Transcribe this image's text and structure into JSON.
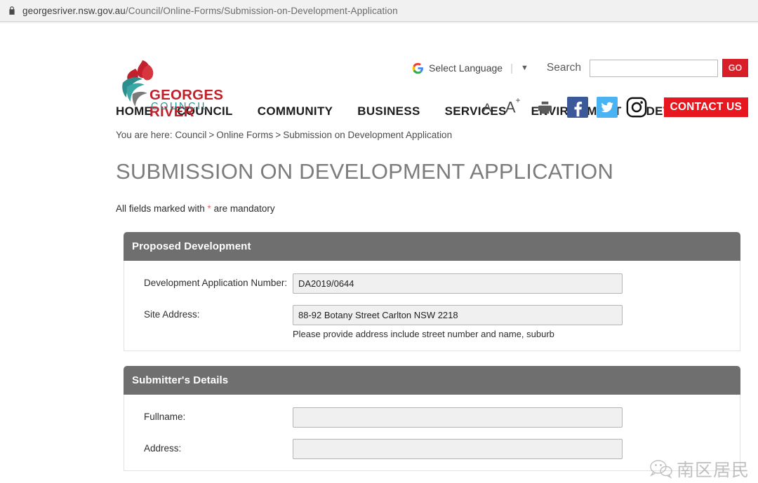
{
  "browser": {
    "lock_icon": "lock-icon",
    "url_prefix": "georgesriver.nsw.gov.au",
    "url_path": "/Council/Online-Forms/Submission-on-Development-Application",
    "url_full": "georgesriver.nsw.gov.au/Council/Online-Forms/Submission-on-Development-Application"
  },
  "header": {
    "logo": {
      "line1": "GEORGES RIVER",
      "line2": "COUNCIL",
      "line1_color": "#c2202b",
      "line2_color": "#2b8f8f",
      "mark_icon": "flame-wave-logo-icon"
    },
    "language": {
      "icon": "google-g-icon",
      "label": "Select Language",
      "separator": "|",
      "caret": "▼"
    },
    "search": {
      "label": "Search",
      "value": "",
      "placeholder": "",
      "button_label": "GO",
      "button_color": "#d81e27"
    },
    "tools": {
      "font_decrease": "A",
      "font_increase": "A",
      "font_increase_sup": "+",
      "print_icon": "printer-icon",
      "facebook_icon": "facebook-icon",
      "facebook_color": "#3b5998",
      "twitter_icon": "twitter-icon",
      "twitter_color": "#4ab3f4",
      "instagram_icon": "instagram-icon",
      "instagram_color": "#111111",
      "contact_label": "CONTACT US",
      "contact_color": "#e8171f"
    }
  },
  "nav": {
    "items": [
      {
        "label": "HOME"
      },
      {
        "label": "COUNCIL"
      },
      {
        "label": "COMMUNITY"
      },
      {
        "label": "BUSINESS"
      },
      {
        "label": "SERVICES"
      },
      {
        "label": "ENVIRONMENT"
      },
      {
        "label": "DEVELOPMENT"
      }
    ]
  },
  "breadcrumb": {
    "prefix": "You are here:",
    "items": [
      "Council",
      "Online Forms",
      "Submission on Development Application"
    ],
    "separator": ">"
  },
  "main": {
    "title": "SUBMISSION ON DEVELOPMENT APPLICATION",
    "mandatory_note_before": "All fields marked with ",
    "mandatory_star": "*",
    "mandatory_note_after": " are mandatory",
    "sections": [
      {
        "heading": "Proposed Development",
        "fields": [
          {
            "label": "Development Application Number:",
            "value": "DA2019/0644",
            "help": ""
          },
          {
            "label": "Site Address:",
            "value": "88-92 Botany Street Carlton NSW 2218",
            "help": "Please provide address include street number and name, suburb"
          }
        ]
      },
      {
        "heading": "Submitter's Details",
        "fields": [
          {
            "label": "Fullname:",
            "value": "",
            "help": ""
          },
          {
            "label": "Address:",
            "value": "",
            "help": ""
          }
        ]
      }
    ]
  },
  "watermark": {
    "icon": "wechat-bubble-icon",
    "text": "南区居民"
  }
}
